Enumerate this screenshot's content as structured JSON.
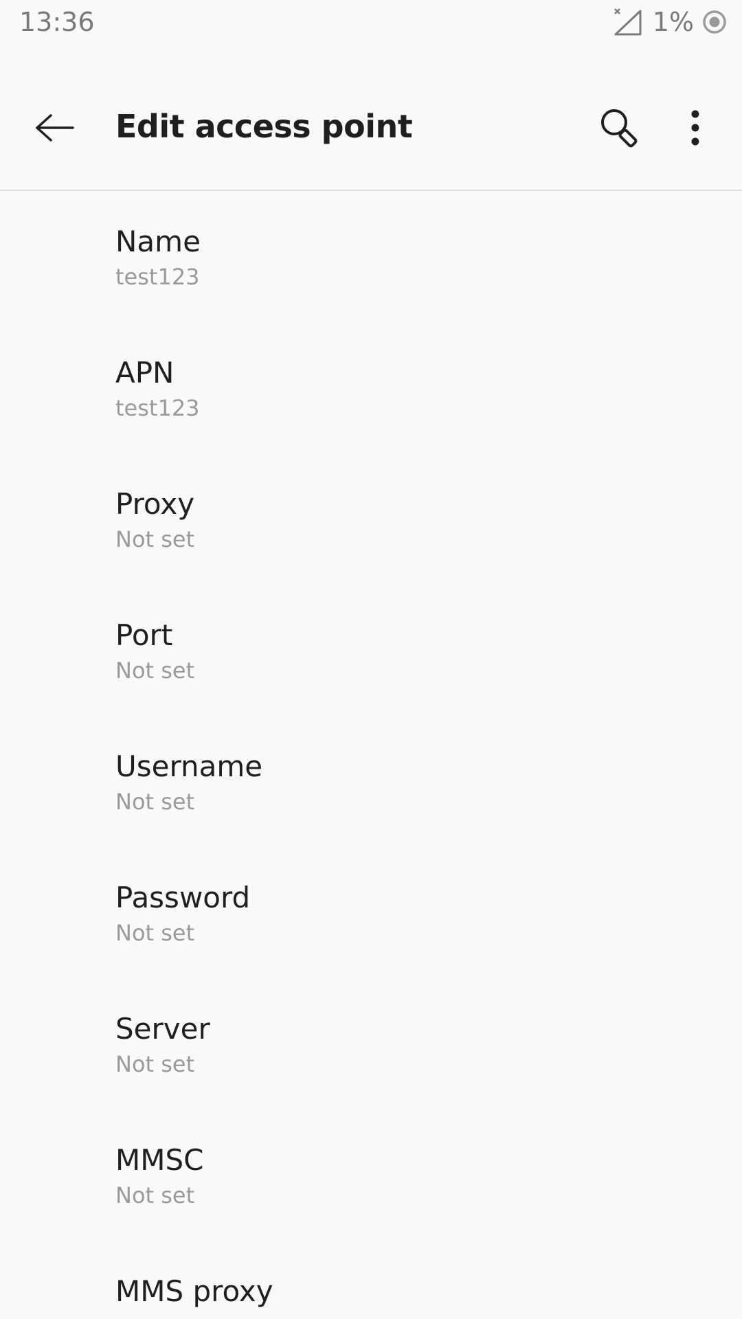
{
  "status_bar": {
    "time": "13:36",
    "battery": "1%",
    "icons": [
      "no-signal-icon",
      "do-not-disturb-icon"
    ]
  },
  "app_bar": {
    "title": "Edit access point",
    "icons": [
      "back-arrow-icon",
      "search-icon",
      "more-vert-icon"
    ]
  },
  "settings": [
    {
      "title": "Name",
      "summary": "test123"
    },
    {
      "title": "APN",
      "summary": "test123"
    },
    {
      "title": "Proxy",
      "summary": "Not set"
    },
    {
      "title": "Port",
      "summary": "Not set"
    },
    {
      "title": "Username",
      "summary": "Not set"
    },
    {
      "title": "Password",
      "summary": "Not set"
    },
    {
      "title": "Server",
      "summary": "Not set"
    },
    {
      "title": "MMSC",
      "summary": "Not set"
    },
    {
      "title": "MMS proxy",
      "summary": ""
    }
  ],
  "colors": {
    "background": "#f9f9f9",
    "title_text": "#1f1f1f",
    "summary_text": "#9a9a9a",
    "status_text": "#7a7a7a",
    "divider": "#dcdcdc"
  }
}
